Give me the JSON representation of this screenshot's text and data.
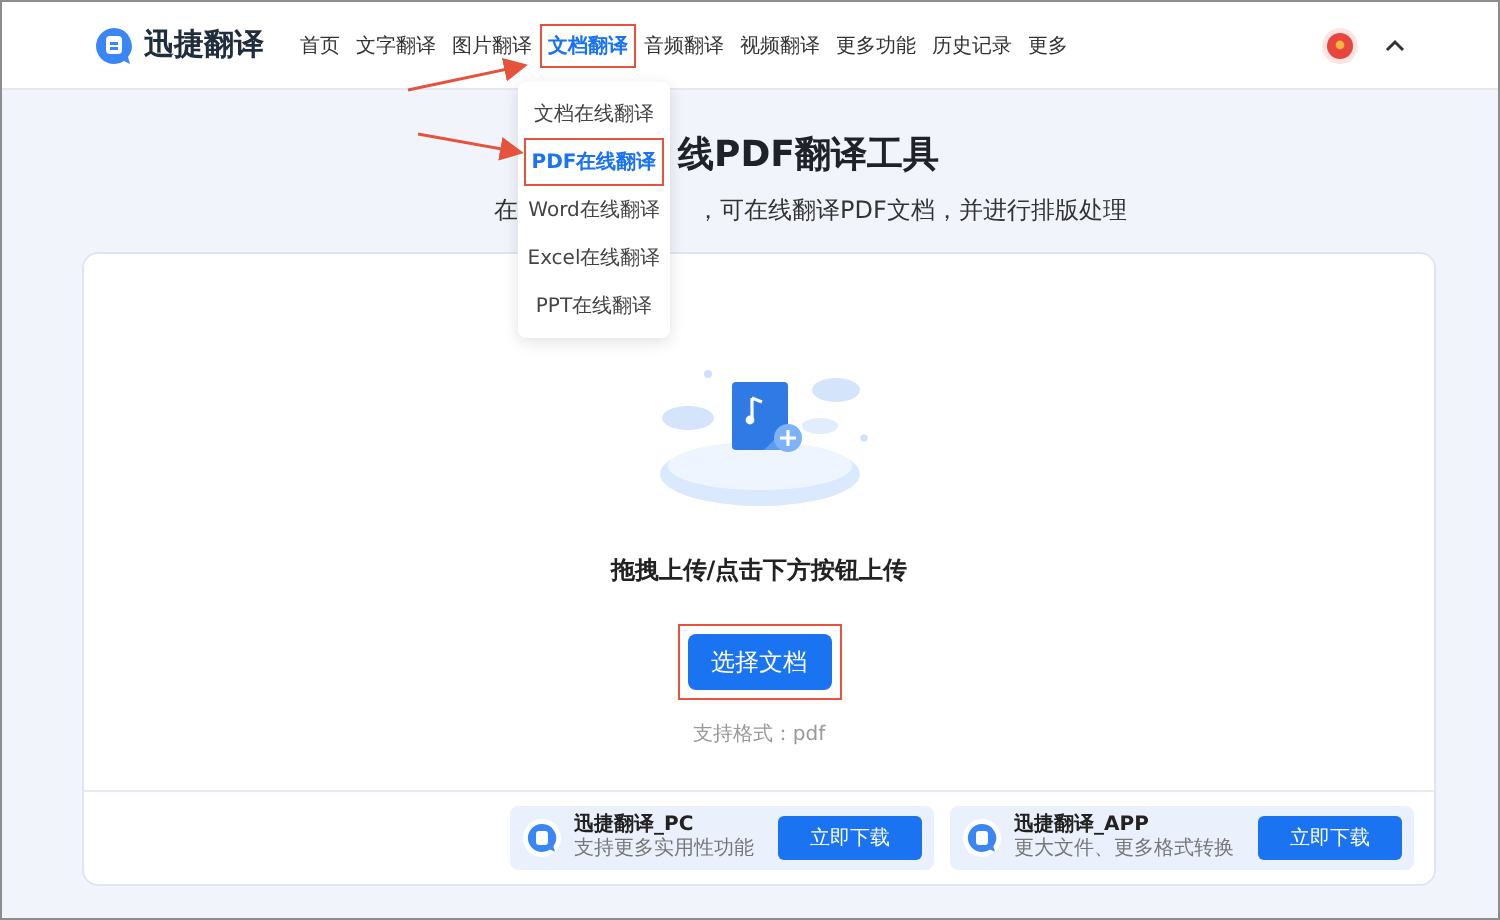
{
  "header": {
    "logo_text": "迅捷翻译",
    "nav": [
      {
        "label": "首页",
        "selected": false,
        "highlighted": false
      },
      {
        "label": "文字翻译",
        "selected": false,
        "highlighted": false
      },
      {
        "label": "图片翻译",
        "selected": false,
        "highlighted": false
      },
      {
        "label": "文档翻译",
        "selected": true,
        "highlighted": true
      },
      {
        "label": "音频翻译",
        "selected": false,
        "highlighted": false
      },
      {
        "label": "视频翻译",
        "selected": false,
        "highlighted": false
      },
      {
        "label": "更多功能",
        "selected": false,
        "highlighted": false
      },
      {
        "label": "历史记录",
        "selected": false,
        "highlighted": false
      },
      {
        "label": "更多",
        "selected": false,
        "highlighted": false
      }
    ]
  },
  "dropdown": {
    "items": [
      {
        "label": "文档在线翻译",
        "selected": false,
        "highlighted": false
      },
      {
        "label": "PDF在线翻译",
        "selected": true,
        "highlighted": true
      },
      {
        "label": "Word在线翻译",
        "selected": false,
        "highlighted": false
      },
      {
        "label": "Excel在线翻译",
        "selected": false,
        "highlighted": false
      },
      {
        "label": "PPT在线翻译",
        "selected": false,
        "highlighted": false
      }
    ]
  },
  "hero": {
    "title": "线PDF翻译工具",
    "subtitle_start": "在",
    "subtitle_end": "，可在线翻译PDF文档，并进行排版处理"
  },
  "upload": {
    "hint": "拖拽上传/点击下方按钮上传",
    "button": {
      "label": "选择文档",
      "highlighted": true
    },
    "formats": "支持格式：pdf"
  },
  "downloads": [
    {
      "title": "迅捷翻译_PC",
      "subtitle": "支持更多实用性功能",
      "button": "立即下载"
    },
    {
      "title": "迅捷翻译_APP",
      "subtitle": "更大文件、更多格式转换",
      "button": "立即下载"
    }
  ]
}
